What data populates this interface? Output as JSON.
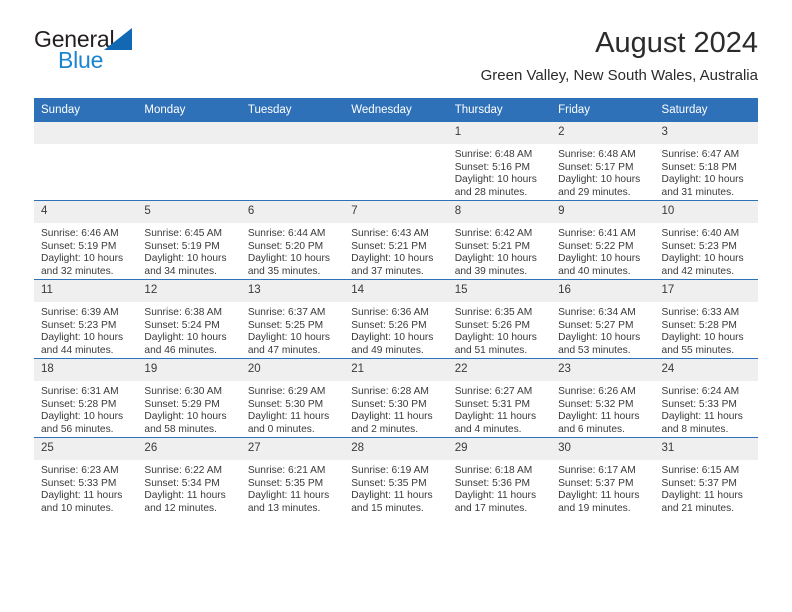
{
  "brand": {
    "name_part1": "General",
    "name_part2": "Blue",
    "logo_icon": "triangle-icon",
    "accent_blue": "#1268b3",
    "text_blue": "#1b84d0"
  },
  "header": {
    "title": "August 2024",
    "subtitle": "Green Valley, New South Wales, Australia"
  },
  "theme": {
    "header_bg": "#2e71b8",
    "daynum_bg": "#efefef",
    "text": "#3a3a3a"
  },
  "weekdays": [
    "Sunday",
    "Monday",
    "Tuesday",
    "Wednesday",
    "Thursday",
    "Friday",
    "Saturday"
  ],
  "weeks": [
    [
      {
        "day": "",
        "sunrise": "",
        "sunset": "",
        "daylight_line1": "",
        "daylight_line2": ""
      },
      {
        "day": "",
        "sunrise": "",
        "sunset": "",
        "daylight_line1": "",
        "daylight_line2": ""
      },
      {
        "day": "",
        "sunrise": "",
        "sunset": "",
        "daylight_line1": "",
        "daylight_line2": ""
      },
      {
        "day": "",
        "sunrise": "",
        "sunset": "",
        "daylight_line1": "",
        "daylight_line2": ""
      },
      {
        "day": "1",
        "sunrise": "Sunrise: 6:48 AM",
        "sunset": "Sunset: 5:16 PM",
        "daylight_line1": "Daylight: 10 hours",
        "daylight_line2": "and 28 minutes."
      },
      {
        "day": "2",
        "sunrise": "Sunrise: 6:48 AM",
        "sunset": "Sunset: 5:17 PM",
        "daylight_line1": "Daylight: 10 hours",
        "daylight_line2": "and 29 minutes."
      },
      {
        "day": "3",
        "sunrise": "Sunrise: 6:47 AM",
        "sunset": "Sunset: 5:18 PM",
        "daylight_line1": "Daylight: 10 hours",
        "daylight_line2": "and 31 minutes."
      }
    ],
    [
      {
        "day": "4",
        "sunrise": "Sunrise: 6:46 AM",
        "sunset": "Sunset: 5:19 PM",
        "daylight_line1": "Daylight: 10 hours",
        "daylight_line2": "and 32 minutes."
      },
      {
        "day": "5",
        "sunrise": "Sunrise: 6:45 AM",
        "sunset": "Sunset: 5:19 PM",
        "daylight_line1": "Daylight: 10 hours",
        "daylight_line2": "and 34 minutes."
      },
      {
        "day": "6",
        "sunrise": "Sunrise: 6:44 AM",
        "sunset": "Sunset: 5:20 PM",
        "daylight_line1": "Daylight: 10 hours",
        "daylight_line2": "and 35 minutes."
      },
      {
        "day": "7",
        "sunrise": "Sunrise: 6:43 AM",
        "sunset": "Sunset: 5:21 PM",
        "daylight_line1": "Daylight: 10 hours",
        "daylight_line2": "and 37 minutes."
      },
      {
        "day": "8",
        "sunrise": "Sunrise: 6:42 AM",
        "sunset": "Sunset: 5:21 PM",
        "daylight_line1": "Daylight: 10 hours",
        "daylight_line2": "and 39 minutes."
      },
      {
        "day": "9",
        "sunrise": "Sunrise: 6:41 AM",
        "sunset": "Sunset: 5:22 PM",
        "daylight_line1": "Daylight: 10 hours",
        "daylight_line2": "and 40 minutes."
      },
      {
        "day": "10",
        "sunrise": "Sunrise: 6:40 AM",
        "sunset": "Sunset: 5:23 PM",
        "daylight_line1": "Daylight: 10 hours",
        "daylight_line2": "and 42 minutes."
      }
    ],
    [
      {
        "day": "11",
        "sunrise": "Sunrise: 6:39 AM",
        "sunset": "Sunset: 5:23 PM",
        "daylight_line1": "Daylight: 10 hours",
        "daylight_line2": "and 44 minutes."
      },
      {
        "day": "12",
        "sunrise": "Sunrise: 6:38 AM",
        "sunset": "Sunset: 5:24 PM",
        "daylight_line1": "Daylight: 10 hours",
        "daylight_line2": "and 46 minutes."
      },
      {
        "day": "13",
        "sunrise": "Sunrise: 6:37 AM",
        "sunset": "Sunset: 5:25 PM",
        "daylight_line1": "Daylight: 10 hours",
        "daylight_line2": "and 47 minutes."
      },
      {
        "day": "14",
        "sunrise": "Sunrise: 6:36 AM",
        "sunset": "Sunset: 5:26 PM",
        "daylight_line1": "Daylight: 10 hours",
        "daylight_line2": "and 49 minutes."
      },
      {
        "day": "15",
        "sunrise": "Sunrise: 6:35 AM",
        "sunset": "Sunset: 5:26 PM",
        "daylight_line1": "Daylight: 10 hours",
        "daylight_line2": "and 51 minutes."
      },
      {
        "day": "16",
        "sunrise": "Sunrise: 6:34 AM",
        "sunset": "Sunset: 5:27 PM",
        "daylight_line1": "Daylight: 10 hours",
        "daylight_line2": "and 53 minutes."
      },
      {
        "day": "17",
        "sunrise": "Sunrise: 6:33 AM",
        "sunset": "Sunset: 5:28 PM",
        "daylight_line1": "Daylight: 10 hours",
        "daylight_line2": "and 55 minutes."
      }
    ],
    [
      {
        "day": "18",
        "sunrise": "Sunrise: 6:31 AM",
        "sunset": "Sunset: 5:28 PM",
        "daylight_line1": "Daylight: 10 hours",
        "daylight_line2": "and 56 minutes."
      },
      {
        "day": "19",
        "sunrise": "Sunrise: 6:30 AM",
        "sunset": "Sunset: 5:29 PM",
        "daylight_line1": "Daylight: 10 hours",
        "daylight_line2": "and 58 minutes."
      },
      {
        "day": "20",
        "sunrise": "Sunrise: 6:29 AM",
        "sunset": "Sunset: 5:30 PM",
        "daylight_line1": "Daylight: 11 hours",
        "daylight_line2": "and 0 minutes."
      },
      {
        "day": "21",
        "sunrise": "Sunrise: 6:28 AM",
        "sunset": "Sunset: 5:30 PM",
        "daylight_line1": "Daylight: 11 hours",
        "daylight_line2": "and 2 minutes."
      },
      {
        "day": "22",
        "sunrise": "Sunrise: 6:27 AM",
        "sunset": "Sunset: 5:31 PM",
        "daylight_line1": "Daylight: 11 hours",
        "daylight_line2": "and 4 minutes."
      },
      {
        "day": "23",
        "sunrise": "Sunrise: 6:26 AM",
        "sunset": "Sunset: 5:32 PM",
        "daylight_line1": "Daylight: 11 hours",
        "daylight_line2": "and 6 minutes."
      },
      {
        "day": "24",
        "sunrise": "Sunrise: 6:24 AM",
        "sunset": "Sunset: 5:33 PM",
        "daylight_line1": "Daylight: 11 hours",
        "daylight_line2": "and 8 minutes."
      }
    ],
    [
      {
        "day": "25",
        "sunrise": "Sunrise: 6:23 AM",
        "sunset": "Sunset: 5:33 PM",
        "daylight_line1": "Daylight: 11 hours",
        "daylight_line2": "and 10 minutes."
      },
      {
        "day": "26",
        "sunrise": "Sunrise: 6:22 AM",
        "sunset": "Sunset: 5:34 PM",
        "daylight_line1": "Daylight: 11 hours",
        "daylight_line2": "and 12 minutes."
      },
      {
        "day": "27",
        "sunrise": "Sunrise: 6:21 AM",
        "sunset": "Sunset: 5:35 PM",
        "daylight_line1": "Daylight: 11 hours",
        "daylight_line2": "and 13 minutes."
      },
      {
        "day": "28",
        "sunrise": "Sunrise: 6:19 AM",
        "sunset": "Sunset: 5:35 PM",
        "daylight_line1": "Daylight: 11 hours",
        "daylight_line2": "and 15 minutes."
      },
      {
        "day": "29",
        "sunrise": "Sunrise: 6:18 AM",
        "sunset": "Sunset: 5:36 PM",
        "daylight_line1": "Daylight: 11 hours",
        "daylight_line2": "and 17 minutes."
      },
      {
        "day": "30",
        "sunrise": "Sunrise: 6:17 AM",
        "sunset": "Sunset: 5:37 PM",
        "daylight_line1": "Daylight: 11 hours",
        "daylight_line2": "and 19 minutes."
      },
      {
        "day": "31",
        "sunrise": "Sunrise: 6:15 AM",
        "sunset": "Sunset: 5:37 PM",
        "daylight_line1": "Daylight: 11 hours",
        "daylight_line2": "and 21 minutes."
      }
    ]
  ]
}
